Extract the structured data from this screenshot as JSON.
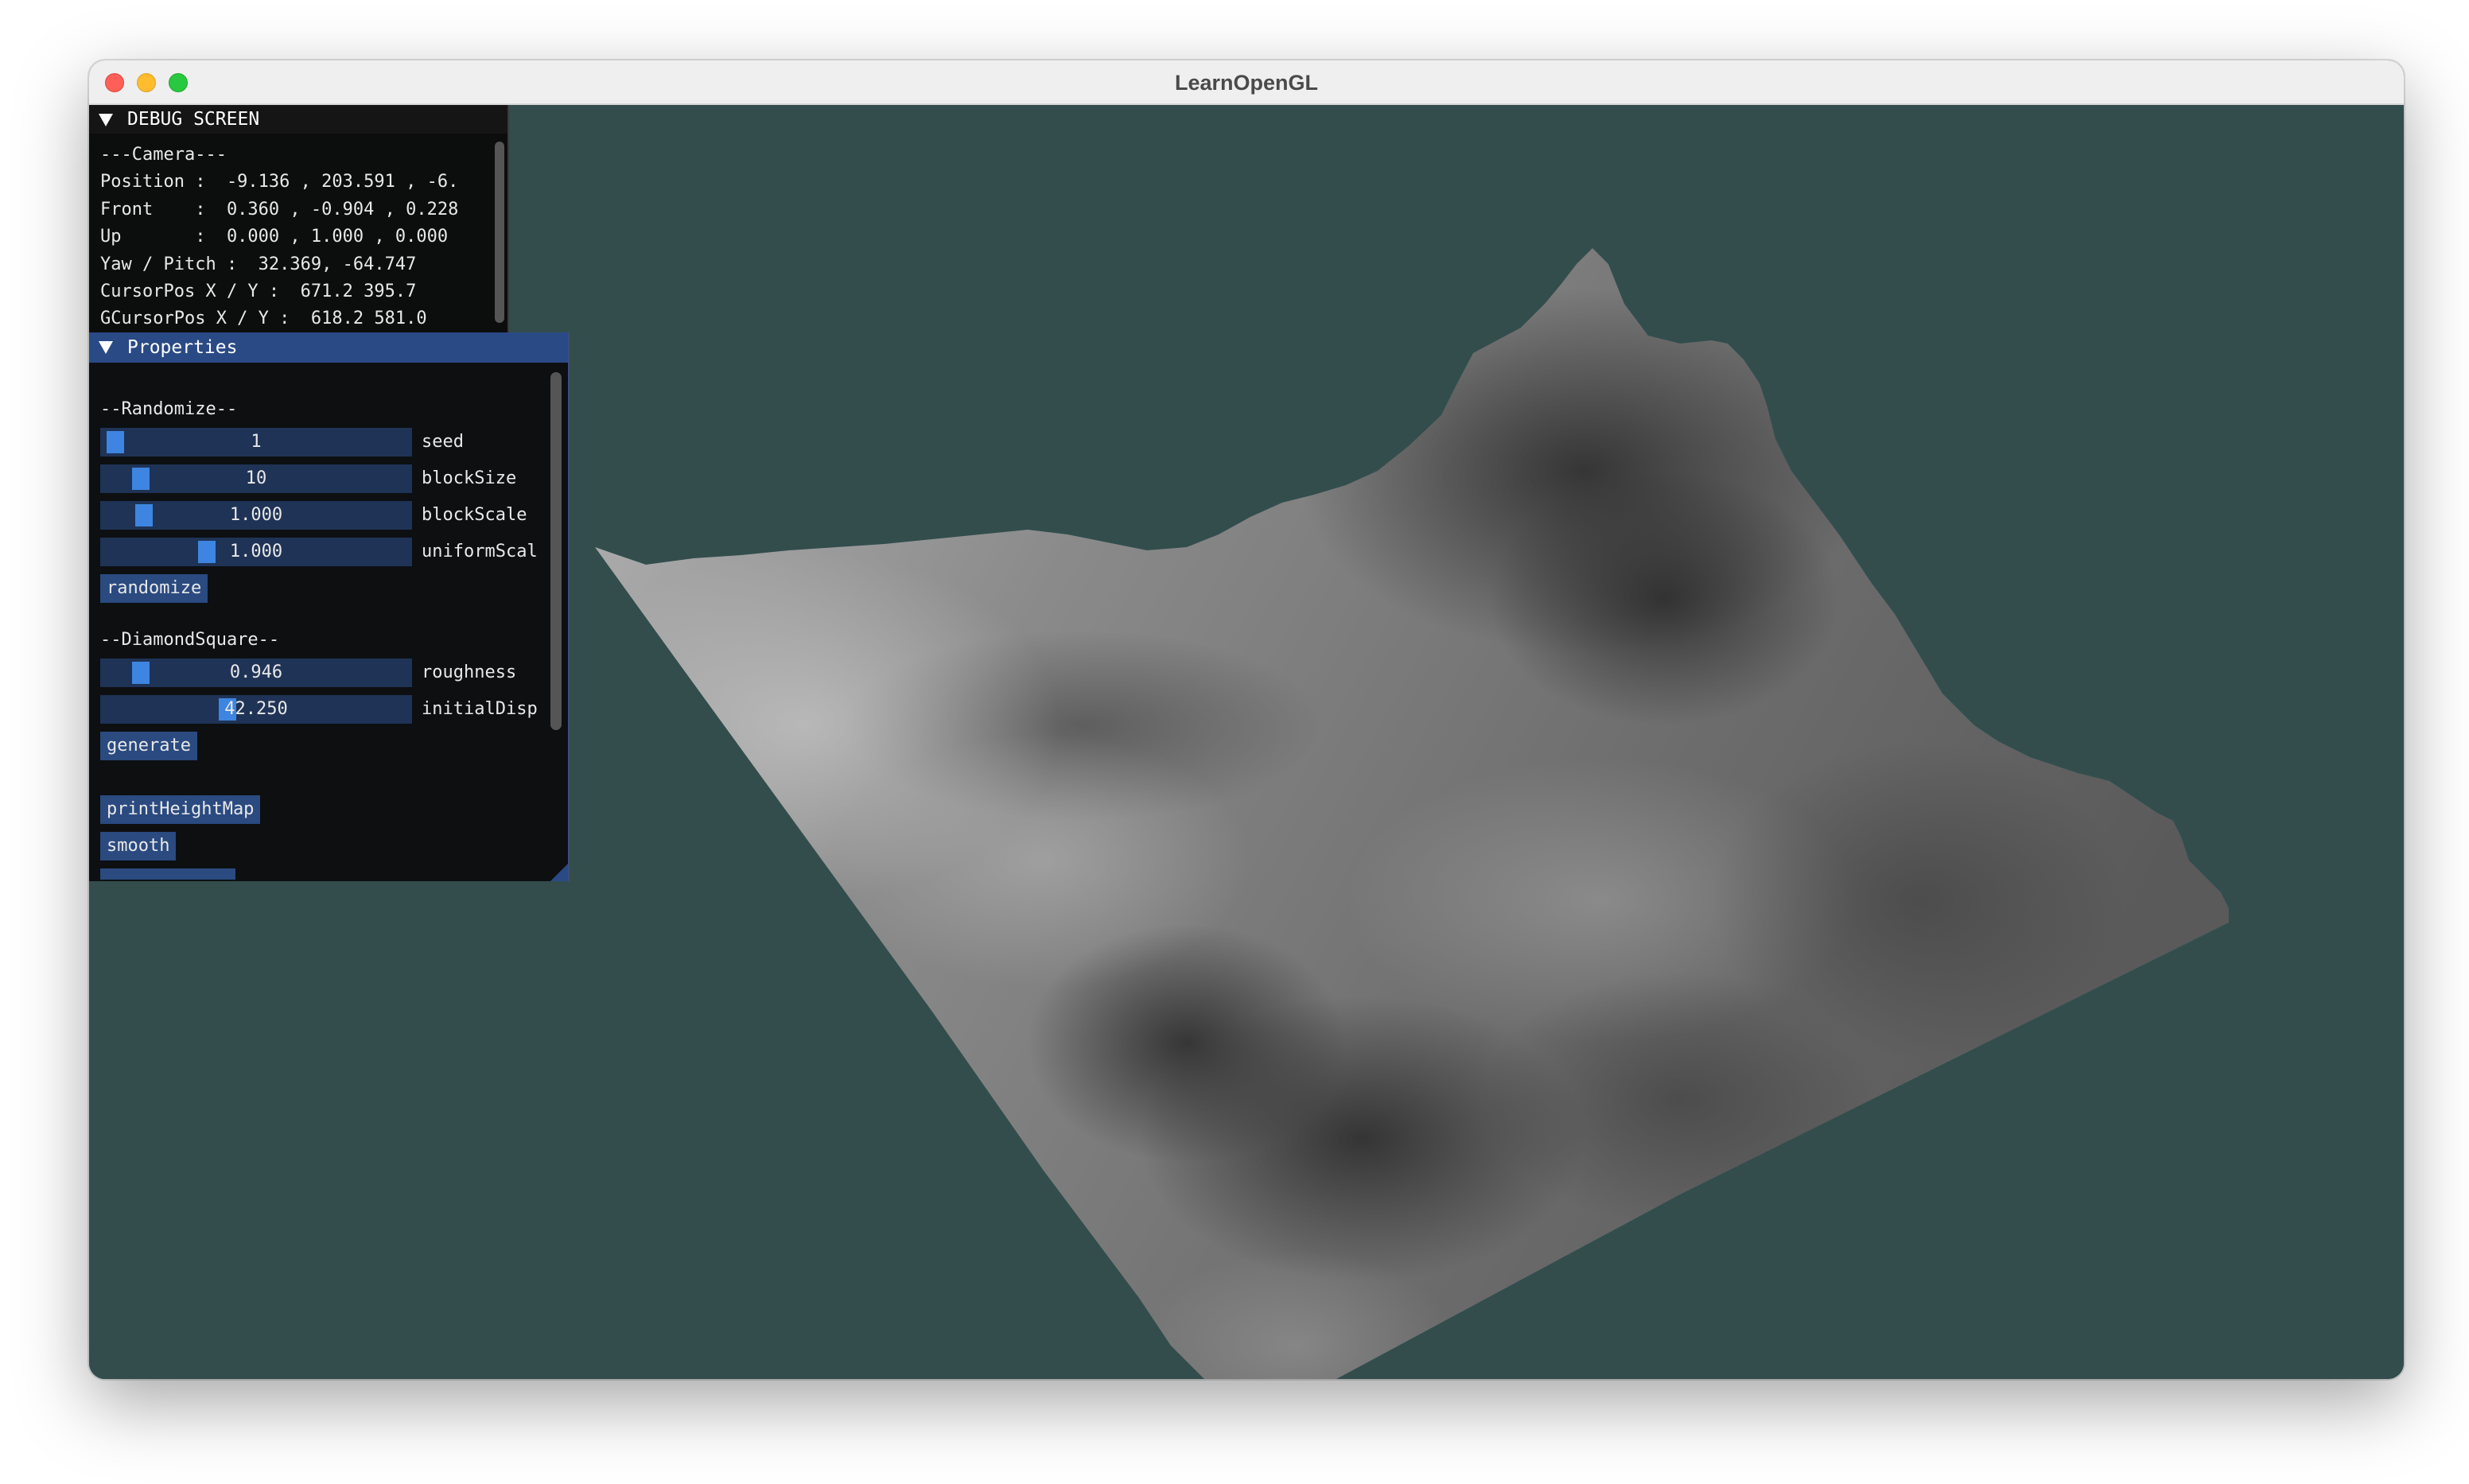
{
  "window": {
    "title": "LearnOpenGL",
    "background_color": "#334d4d"
  },
  "debug_panel": {
    "title": "DEBUG SCREEN",
    "lines": [
      "---Camera---",
      "Position :  -9.136 , 203.591 , -6.",
      "Front    :  0.360 , -0.904 , 0.228",
      "Up       :  0.000 , 1.000 , 0.000",
      "Yaw / Pitch :  32.369, -64.747",
      "CursorPos X / Y :  671.2 395.7",
      "GCursorPos X / Y :  618.2 581.0"
    ]
  },
  "properties_panel": {
    "title": "Properties",
    "randomize_section": "--Randomize--",
    "sliders_randomize": [
      {
        "label": "seed",
        "value": "1",
        "level": 0.01
      },
      {
        "label": "blockSize",
        "value": "10",
        "level": 0.1
      },
      {
        "label": "blockScale",
        "value": "1.000",
        "level": 0.11
      },
      {
        "label": "uniformScal",
        "value": "1.000",
        "level": 0.33
      }
    ],
    "randomize_button": "randomize",
    "diamond_section": "--DiamondSquare--",
    "sliders_diamond": [
      {
        "label": "roughness",
        "value": "0.946",
        "level": 0.1
      },
      {
        "label": "initialDisp",
        "value": "42.250",
        "level": 0.4
      }
    ],
    "generate_button": "generate",
    "print_button": "printHeightMap",
    "smooth_button": "smooth"
  },
  "accent_color": "#3d85e0",
  "icons": [
    "collapse-arrow-icon",
    "traffic-light-close",
    "traffic-light-minimize",
    "traffic-light-zoom"
  ]
}
